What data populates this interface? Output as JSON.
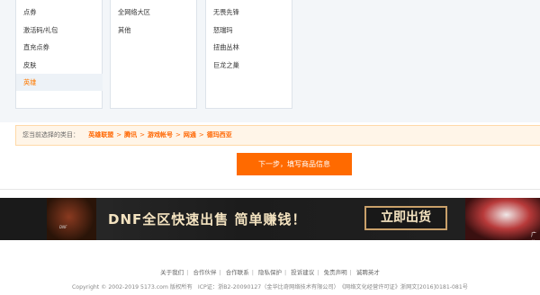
{
  "categories": {
    "col1": [
      "点券",
      "激活码/礼包",
      "直充点券",
      "皮肤",
      "英雄"
    ],
    "col2": [
      "全网络大区",
      "其他"
    ],
    "col3": [
      "无畏先锋",
      "怒瑞玛",
      "扭曲丛林",
      "巨龙之巢"
    ],
    "selected": "英雄"
  },
  "breadcrumb": {
    "prefix": "您当前选择的类目：",
    "items": [
      "英雄联盟",
      "腾讯",
      "游戏帐号",
      "网通",
      "德玛西亚"
    ],
    "separator": ">"
  },
  "next_button": "下一步，填写商品信息",
  "banner": {
    "logo_text": "DNF",
    "slogan": "DNF全区快速出售 简单赚钱！",
    "button": "立即出货",
    "corner": "广告"
  },
  "footer": {
    "links": [
      "关于我们",
      "合作伙伴",
      "合作联系",
      "隐私保护",
      "投诉建议",
      "免责声明",
      "诚聘英才"
    ],
    "copyright": "Copyright © 2002-2019 5173.com 版权所有　ICP证：浙B2-20090127（金华比奇网络技术有限公司）　《网络文化经营许可证》浙网文[2016]0181-081号"
  },
  "colors": {
    "accent": "#ff6a00",
    "background": "#f3f6f9"
  }
}
